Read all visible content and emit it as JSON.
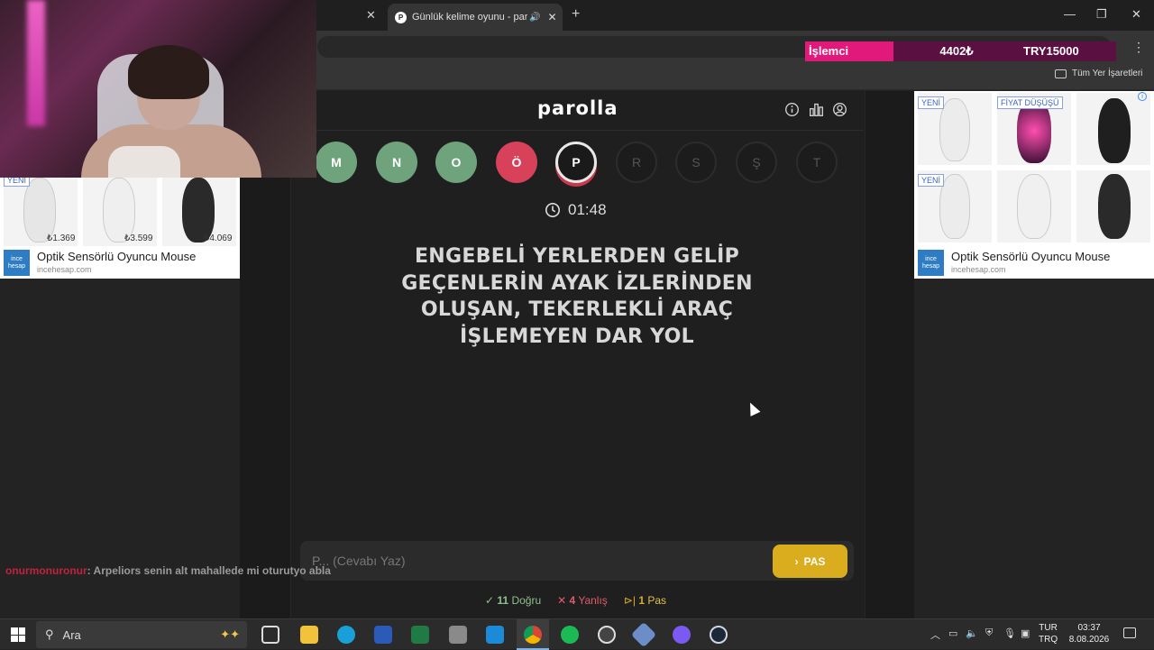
{
  "browser": {
    "tab_title": "Günlük kelime oyunu - parolla",
    "tab_favicon": "P",
    "bookmarks_all_label": "Tüm Yer İşaretleri"
  },
  "ticker": {
    "label": "İşlemci",
    "price": "4402₺",
    "alt": "TRY15000"
  },
  "game": {
    "logo": "parolla",
    "letters": [
      {
        "char": "M",
        "state": "correct"
      },
      {
        "char": "N",
        "state": "correct"
      },
      {
        "char": "O",
        "state": "correct"
      },
      {
        "char": "Ö",
        "state": "wrong"
      },
      {
        "char": "P",
        "state": "current"
      },
      {
        "char": "R",
        "state": "pending"
      },
      {
        "char": "S",
        "state": "pending"
      },
      {
        "char": "Ş",
        "state": "pending"
      },
      {
        "char": "T",
        "state": "pending"
      }
    ],
    "timer": "01:48",
    "question": "ENGEBELİ YERLERDEN GELİP GEÇENLERİN AYAK İZLERİNDEN OLUŞAN, TEKERLEKLİ ARAÇ İŞLEMEYEN DAR YOL",
    "answer_placeholder": "P... (Cevabı Yaz)",
    "pas_label": "PAS",
    "stats": {
      "correct_count": "11",
      "correct_label": "Doğru",
      "wrong_count": "4",
      "wrong_label": "Yanlış",
      "pass_count": "1",
      "pass_label": "Pas"
    },
    "colors": {
      "correct": "#6fa37c",
      "wrong": "#d8415a",
      "pas": "#d9ad1e"
    }
  },
  "ads": {
    "left": {
      "title": "Optik Sensörlü Oyuncu Mouse",
      "url": "incehesap.com",
      "badge": "YENİ",
      "prices": [
        "₺1.369",
        "₺3.599",
        "₺4.069"
      ],
      "logo": "ince hesap"
    },
    "right": {
      "title": "Optik Sensörlü Oyuncu Mouse",
      "url": "incehesap.com",
      "badges": [
        "YENİ",
        "FİYAT DÜŞÜŞÜ",
        "YENİ"
      ],
      "logo": "ince hesap"
    }
  },
  "chat": {
    "user": "onurmonuronur",
    "message": ": Arpeliors senin alt mahallede mi oturutyo abla"
  },
  "taskbar": {
    "search_label": "Ara",
    "lang_top": "TUR",
    "lang_bottom": "TRQ",
    "time": "03:37",
    "date": "8.08.2026"
  }
}
